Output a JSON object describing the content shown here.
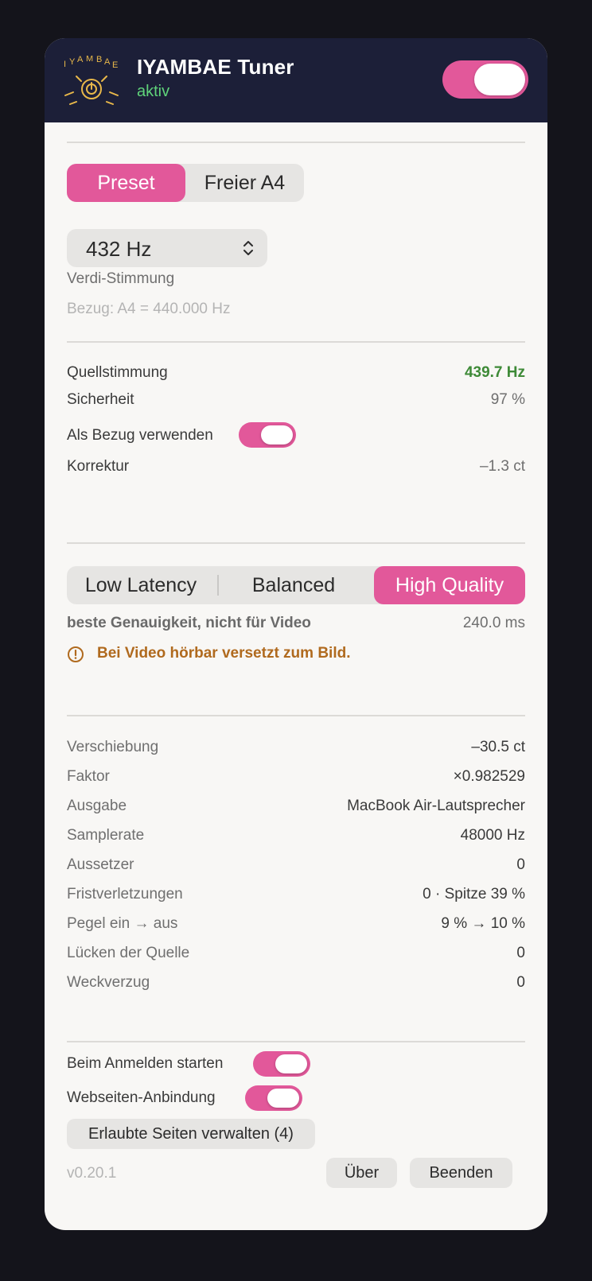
{
  "header": {
    "logo_text": "IYAMBAE",
    "title": "IYAMBAE Tuner",
    "status": "aktiv",
    "power_on": true
  },
  "tuning": {
    "modes": [
      "Preset",
      "Freier A4"
    ],
    "selected_mode": "Preset",
    "preset_value": "432 Hz",
    "preset_name": "Verdi-Stimmung",
    "reference": "Bezug: A4 = 440.000 Hz"
  },
  "source": {
    "pitch_label": "Quellstimmung",
    "pitch_value": "439.7 Hz",
    "confidence_label": "Sicherheit",
    "confidence_value": "97 %",
    "use_as_reference_label": "Als Bezug verwenden",
    "use_as_reference_on": true,
    "correction_label": "Korrektur",
    "correction_value": "–1.3 ct"
  },
  "quality": {
    "options": [
      "Low Latency",
      "Balanced",
      "High Quality"
    ],
    "selected": "High Quality",
    "description": "beste Genauigkeit, nicht für Video",
    "latency": "240.0 ms",
    "warning": "Bei Video hörbar versetzt zum Bild."
  },
  "stats": [
    {
      "label": "Verschiebung",
      "value": "–30.5 ct"
    },
    {
      "label": "Faktor",
      "value": "×0.982529"
    },
    {
      "label": "Ausgabe",
      "value": "MacBook Air-Lautsprecher"
    },
    {
      "label": "Samplerate",
      "value": "48000 Hz"
    },
    {
      "label": "Aussetzer",
      "value": "0"
    },
    {
      "label": "Fristverletzungen",
      "value": "0 · Spitze 39 %"
    },
    {
      "label": "Pegel ein → aus",
      "value": "9 % → 10 %"
    },
    {
      "label": "Lücken der Quelle",
      "value": "0"
    },
    {
      "label": "Weckverzug",
      "value": "0"
    }
  ],
  "settings": {
    "launch_at_login_label": "Beim Anmelden starten",
    "launch_at_login_on": true,
    "web_binding_label": "Webseiten-Anbindung",
    "web_binding_on": true,
    "manage_sites_label": "Erlaubte Seiten verwalten (4)"
  },
  "footer": {
    "version": "v0.20.1",
    "about_label": "Über",
    "quit_label": "Beenden"
  },
  "colors": {
    "accent": "#e2589a",
    "header_bg": "#1c1f38",
    "status_green": "#5fd37a",
    "warning_orange": "#b06a1e"
  }
}
